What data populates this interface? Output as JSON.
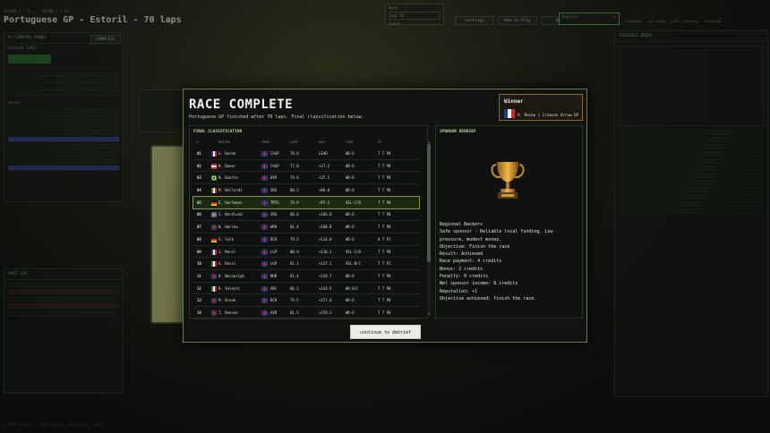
{
  "background": {
    "breadcrumb": "SEASON 1 / R... · ROUND 1 / 16",
    "race_title": "Portuguese GP - Estoril - 70 laps",
    "topbar": {
      "box1_label": "Race",
      "box1_value": "Lap 70",
      "box2_label": "Speed",
      "btn_settings": "Settings",
      "btn_how_to_play": "How to Play",
      "btn_quit": "Quit",
      "select_value": "English",
      "right_text": "Standings · All-teams · Info · Results · Standings"
    },
    "left_panel": {
      "header": "P1 CONTROL PANEL",
      "complete_label": "COMPLETE",
      "sub_header": "SESSION TIMER",
      "drivers_header": "DRIVER",
      "race_log_header": "RACE LOG"
    },
    "right_panel": {
      "header": "STRATEGY BRIEF"
    },
    "footer": "© 2024 Estoril · Race engine simulation · v0.1"
  },
  "modal": {
    "title": "RACE COMPLETE",
    "subtitle": "Portuguese GP finished after 70 laps. Final classification below.",
    "winner": {
      "label": "Winner",
      "text": "A. Roche | Crimson Arrow GP"
    },
    "classification": {
      "heading": "FINAL CLASSIFICATION",
      "columns": [
        "P",
        "DRIVER",
        "TEAM",
        "LAST",
        "GAP",
        "TYRE",
        "ST"
      ],
      "rows": [
        {
          "pos": "01",
          "driver": "A. Roche",
          "team": "CAGP",
          "last": "78.8",
          "gap": "LEAD",
          "tyre": "WD-D",
          "st": "T T P0",
          "flag": "fr",
          "tflag": "uk"
        },
        {
          "pos": "02",
          "driver": "N. Bauer",
          "team": "CAGP",
          "last": "77.0",
          "gap": "+27.3",
          "tyre": "WD-D",
          "st": "T T P0",
          "flag": "at",
          "tflag": "uk"
        },
        {
          "pos": "03",
          "driver": "N. Duarte",
          "team": "DVR",
          "last": "79.6",
          "gap": "+37.5",
          "tyre": "WD-D",
          "st": "T T P0",
          "flag": "br",
          "tflag": "uk"
        },
        {
          "pos": "04",
          "driver": "M. Bellardi",
          "team": "SRG",
          "last": "80.5",
          "gap": "+88.0",
          "tyre": "WD-D",
          "st": "T T P0",
          "flag": "it",
          "tflag": "uk"
        },
        {
          "pos": "05",
          "driver": "E. Hartmann",
          "team": "TMTG",
          "last": "79.9",
          "gap": "+97.5",
          "tyre": "VEL-C/B",
          "st": "T T P0",
          "flag": "de",
          "tflag": "uk"
        },
        {
          "pos": "06",
          "driver": "S. Nordlund",
          "team": "SRG",
          "last": "80.6",
          "gap": "+106.8",
          "tyre": "WD-D",
          "st": "T T P0",
          "flag": "se",
          "tflag": "uk"
        },
        {
          "pos": "07",
          "driver": "N. Harrow",
          "team": "WDR",
          "last": "81.4",
          "gap": "+108.0",
          "tyre": "WD-D",
          "st": "T T P0",
          "flag": "uk",
          "tflag": "uk"
        },
        {
          "pos": "08",
          "driver": "S. Falk",
          "team": "BCR",
          "last": "79.5",
          "gap": "+114.0",
          "tyre": "WD-D",
          "st": "A T P1",
          "flag": "de",
          "tflag": "uk"
        },
        {
          "pos": "09",
          "driver": "J. Morel",
          "team": "LGP",
          "last": "80.9",
          "gap": "+116.1",
          "tyre": "VEL-C/B",
          "st": "T T P0",
          "flag": "fr",
          "tflag": "uk"
        },
        {
          "pos": "10",
          "driver": "A. Rossi",
          "team": "LGP",
          "last": "81.1",
          "gap": "+137.1",
          "tyre": "VEL-B/C",
          "st": "T T P1",
          "flag": "it",
          "tflag": "uk"
        },
        {
          "pos": "11",
          "driver": "D. Wainwrigh",
          "team": "NUR",
          "last": "81.4",
          "gap": "+139.7",
          "tyre": "WD-D",
          "st": "T T P0",
          "flag": "uk",
          "tflag": "uk"
        },
        {
          "pos": "12",
          "driver": "R. Valenti",
          "team": "ARC",
          "last": "80.2",
          "gap": "+143.9",
          "tyre": "WD-B/C",
          "st": "T T P0",
          "flag": "it",
          "tflag": "uk"
        },
        {
          "pos": "13",
          "driver": "M. Brook",
          "team": "BCR",
          "last": "79.5",
          "gap": "+157.8",
          "tyre": "WD-D",
          "st": "T T P0",
          "flag": "uk",
          "tflag": "uk"
        },
        {
          "pos": "14",
          "driver": "T. Benson",
          "team": "AVR",
          "last": "81.5",
          "gap": "+159.3",
          "tyre": "WD-D",
          "st": "T T P0",
          "flag": "uk",
          "tflag": "uk"
        }
      ]
    },
    "sponsor": {
      "heading": "SPONSOR DEBRIEF",
      "icon": "trophy-icon",
      "lines": [
        "Regional Backers",
        "Safe sponsor - Reliable local funding. Low",
        "pressure, modest money.",
        "Objective: Finish the race",
        "Result: Achieved",
        "Race payment: 4 credits",
        "Bonus: 2 credits",
        "Penalty: 0 credits",
        "Net sponsor income: 6 credits",
        "Reputation: +1",
        "Objective achieved: finish the race."
      ]
    },
    "continue_label": "continue to debrief"
  }
}
